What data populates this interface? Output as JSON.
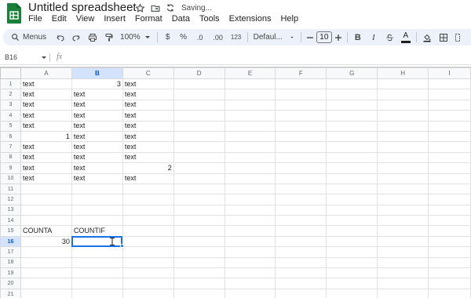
{
  "app": {
    "title": "Untitled spreadsheet",
    "status": "Saving...",
    "brand_color": "#188038",
    "selection_color": "#1a73e8"
  },
  "menu": [
    "File",
    "Edit",
    "View",
    "Insert",
    "Format",
    "Data",
    "Tools",
    "Extensions",
    "Help"
  ],
  "toolbar": {
    "search_label": "Menus",
    "zoom": "100%",
    "currency": "$",
    "percent": "%",
    "decrease_decimal": ".0",
    "increase_decimal": ".00",
    "number_format": "123",
    "font": "Defaul...",
    "font_size": "10",
    "bold": "B",
    "italic": "I",
    "text_color": "A"
  },
  "formula_bar": {
    "cell_ref": "B16",
    "fx": "fx",
    "content": ""
  },
  "sheet": {
    "columns": [
      "A",
      "B",
      "C",
      "D",
      "E",
      "F",
      "G",
      "H",
      "I"
    ],
    "active_column": "B",
    "active_row": "16",
    "rows": [
      {
        "n": "1",
        "cells": [
          {
            "v": "text"
          },
          {
            "v": "3",
            "num": true
          },
          {
            "v": "text"
          },
          {
            "v": ""
          },
          {
            "v": ""
          },
          {
            "v": ""
          },
          {
            "v": ""
          },
          {
            "v": ""
          },
          {
            "v": ""
          }
        ]
      },
      {
        "n": "2",
        "cells": [
          {
            "v": "text"
          },
          {
            "v": "text"
          },
          {
            "v": "text"
          },
          {
            "v": ""
          },
          {
            "v": ""
          },
          {
            "v": ""
          },
          {
            "v": ""
          },
          {
            "v": ""
          },
          {
            "v": ""
          }
        ]
      },
      {
        "n": "3",
        "cells": [
          {
            "v": "text"
          },
          {
            "v": "text"
          },
          {
            "v": "text"
          },
          {
            "v": ""
          },
          {
            "v": ""
          },
          {
            "v": ""
          },
          {
            "v": ""
          },
          {
            "v": ""
          },
          {
            "v": ""
          }
        ]
      },
      {
        "n": "4",
        "cells": [
          {
            "v": "text"
          },
          {
            "v": "text"
          },
          {
            "v": "text"
          },
          {
            "v": ""
          },
          {
            "v": ""
          },
          {
            "v": ""
          },
          {
            "v": ""
          },
          {
            "v": ""
          },
          {
            "v": ""
          }
        ]
      },
      {
        "n": "5",
        "cells": [
          {
            "v": "text"
          },
          {
            "v": "text"
          },
          {
            "v": "text"
          },
          {
            "v": ""
          },
          {
            "v": ""
          },
          {
            "v": ""
          },
          {
            "v": ""
          },
          {
            "v": ""
          },
          {
            "v": ""
          }
        ]
      },
      {
        "n": "6",
        "cells": [
          {
            "v": "1",
            "num": true
          },
          {
            "v": "text"
          },
          {
            "v": "text"
          },
          {
            "v": ""
          },
          {
            "v": ""
          },
          {
            "v": ""
          },
          {
            "v": ""
          },
          {
            "v": ""
          },
          {
            "v": ""
          }
        ]
      },
      {
        "n": "7",
        "cells": [
          {
            "v": "text"
          },
          {
            "v": "text"
          },
          {
            "v": "text"
          },
          {
            "v": ""
          },
          {
            "v": ""
          },
          {
            "v": ""
          },
          {
            "v": ""
          },
          {
            "v": ""
          },
          {
            "v": ""
          }
        ]
      },
      {
        "n": "8",
        "cells": [
          {
            "v": "text"
          },
          {
            "v": "text"
          },
          {
            "v": "text"
          },
          {
            "v": ""
          },
          {
            "v": ""
          },
          {
            "v": ""
          },
          {
            "v": ""
          },
          {
            "v": ""
          },
          {
            "v": ""
          }
        ]
      },
      {
        "n": "9",
        "cells": [
          {
            "v": "text"
          },
          {
            "v": "text"
          },
          {
            "v": "2",
            "num": true
          },
          {
            "v": ""
          },
          {
            "v": ""
          },
          {
            "v": ""
          },
          {
            "v": ""
          },
          {
            "v": ""
          },
          {
            "v": ""
          }
        ]
      },
      {
        "n": "10",
        "cells": [
          {
            "v": "text"
          },
          {
            "v": "text"
          },
          {
            "v": "text"
          },
          {
            "v": ""
          },
          {
            "v": ""
          },
          {
            "v": ""
          },
          {
            "v": ""
          },
          {
            "v": ""
          },
          {
            "v": ""
          }
        ]
      },
      {
        "n": "11",
        "cells": [
          {
            "v": ""
          },
          {
            "v": ""
          },
          {
            "v": ""
          },
          {
            "v": ""
          },
          {
            "v": ""
          },
          {
            "v": ""
          },
          {
            "v": ""
          },
          {
            "v": ""
          },
          {
            "v": ""
          }
        ]
      },
      {
        "n": "12",
        "cells": [
          {
            "v": ""
          },
          {
            "v": ""
          },
          {
            "v": ""
          },
          {
            "v": ""
          },
          {
            "v": ""
          },
          {
            "v": ""
          },
          {
            "v": ""
          },
          {
            "v": ""
          },
          {
            "v": ""
          }
        ]
      },
      {
        "n": "13",
        "cells": [
          {
            "v": ""
          },
          {
            "v": ""
          },
          {
            "v": ""
          },
          {
            "v": ""
          },
          {
            "v": ""
          },
          {
            "v": ""
          },
          {
            "v": ""
          },
          {
            "v": ""
          },
          {
            "v": ""
          }
        ]
      },
      {
        "n": "14",
        "cells": [
          {
            "v": ""
          },
          {
            "v": ""
          },
          {
            "v": ""
          },
          {
            "v": ""
          },
          {
            "v": ""
          },
          {
            "v": ""
          },
          {
            "v": ""
          },
          {
            "v": ""
          },
          {
            "v": ""
          }
        ]
      },
      {
        "n": "15",
        "cells": [
          {
            "v": "COUNTA"
          },
          {
            "v": "COUNTIF"
          },
          {
            "v": ""
          },
          {
            "v": ""
          },
          {
            "v": ""
          },
          {
            "v": ""
          },
          {
            "v": ""
          },
          {
            "v": ""
          },
          {
            "v": ""
          }
        ]
      },
      {
        "n": "16",
        "cells": [
          {
            "v": "30",
            "num": true
          },
          {
            "v": "",
            "selected": true
          },
          {
            "v": ""
          },
          {
            "v": ""
          },
          {
            "v": ""
          },
          {
            "v": ""
          },
          {
            "v": ""
          },
          {
            "v": ""
          },
          {
            "v": ""
          }
        ]
      },
      {
        "n": "17",
        "cells": [
          {
            "v": ""
          },
          {
            "v": ""
          },
          {
            "v": ""
          },
          {
            "v": ""
          },
          {
            "v": ""
          },
          {
            "v": ""
          },
          {
            "v": ""
          },
          {
            "v": ""
          },
          {
            "v": ""
          }
        ]
      },
      {
        "n": "18",
        "cells": [
          {
            "v": ""
          },
          {
            "v": ""
          },
          {
            "v": ""
          },
          {
            "v": ""
          },
          {
            "v": ""
          },
          {
            "v": ""
          },
          {
            "v": ""
          },
          {
            "v": ""
          },
          {
            "v": ""
          }
        ]
      },
      {
        "n": "19",
        "cells": [
          {
            "v": ""
          },
          {
            "v": ""
          },
          {
            "v": ""
          },
          {
            "v": ""
          },
          {
            "v": ""
          },
          {
            "v": ""
          },
          {
            "v": ""
          },
          {
            "v": ""
          },
          {
            "v": ""
          }
        ]
      },
      {
        "n": "20",
        "cells": [
          {
            "v": ""
          },
          {
            "v": ""
          },
          {
            "v": ""
          },
          {
            "v": ""
          },
          {
            "v": ""
          },
          {
            "v": ""
          },
          {
            "v": ""
          },
          {
            "v": ""
          },
          {
            "v": ""
          }
        ]
      },
      {
        "n": "21",
        "cells": [
          {
            "v": ""
          },
          {
            "v": ""
          },
          {
            "v": ""
          },
          {
            "v": ""
          },
          {
            "v": ""
          },
          {
            "v": ""
          },
          {
            "v": ""
          },
          {
            "v": ""
          },
          {
            "v": ""
          }
        ]
      }
    ]
  }
}
